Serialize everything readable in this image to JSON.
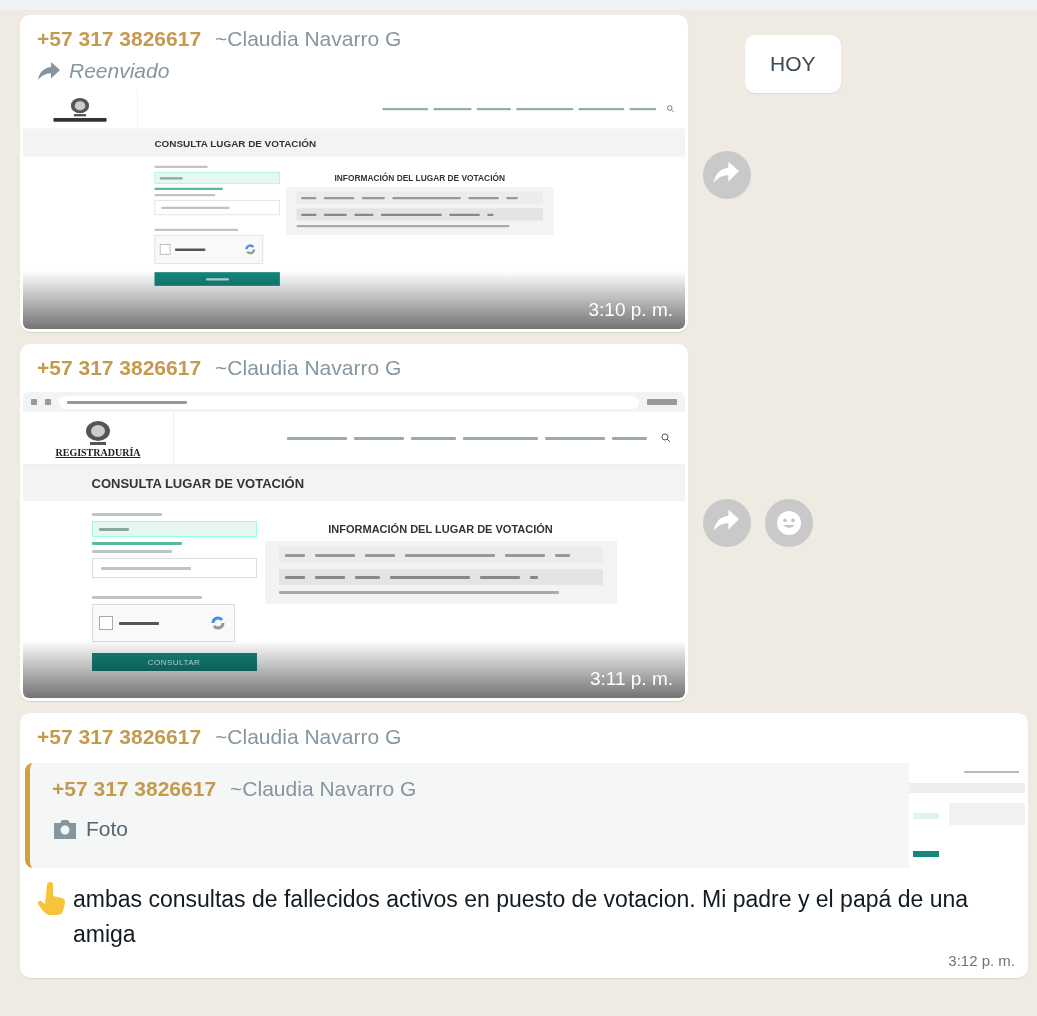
{
  "date_chip": "HOY",
  "messages": [
    {
      "kind": "image",
      "sender_phone": "+57 317 3826617",
      "sender_name": "~Claudia Navarro G",
      "forwarded": true,
      "forwarded_label": "Reenviado",
      "time": "3:10 p. m.",
      "actions": [
        {
          "kind": "forward"
        }
      ],
      "shot": {
        "browser_bar": false,
        "title": "CONSULTA LUGAR DE VOTACIÓN",
        "info_title": "INFORMACIÓN DEL LUGAR DE VOTACIÓN"
      }
    },
    {
      "kind": "image",
      "sender_phone": "+57 317 3826617",
      "sender_name": "~Claudia Navarro G",
      "forwarded": false,
      "time": "3:11 p. m.",
      "actions": [
        {
          "kind": "forward"
        },
        {
          "kind": "react"
        }
      ],
      "shot": {
        "browser_bar": true,
        "brand": "REGISTRADURÍA",
        "title": "CONSULTA LUGAR DE VOTACIÓN",
        "info_title": "INFORMACIÓN DEL LUGAR DE VOTACIÓN",
        "button": "CONSULTAR"
      }
    },
    {
      "kind": "reply",
      "sender_phone": "+57 317 3826617",
      "sender_name": "~Claudia Navarro G",
      "forwarded": false,
      "quote": {
        "sender_phone": "+57 317 3826617",
        "sender_name": "~Claudia Navarro G",
        "media_label": "Foto"
      },
      "text": "ambas consultas de fallecidos activos en puesto de votacion. Mi padre y el papá de una amiga",
      "time": "3:12 p. m."
    }
  ]
}
